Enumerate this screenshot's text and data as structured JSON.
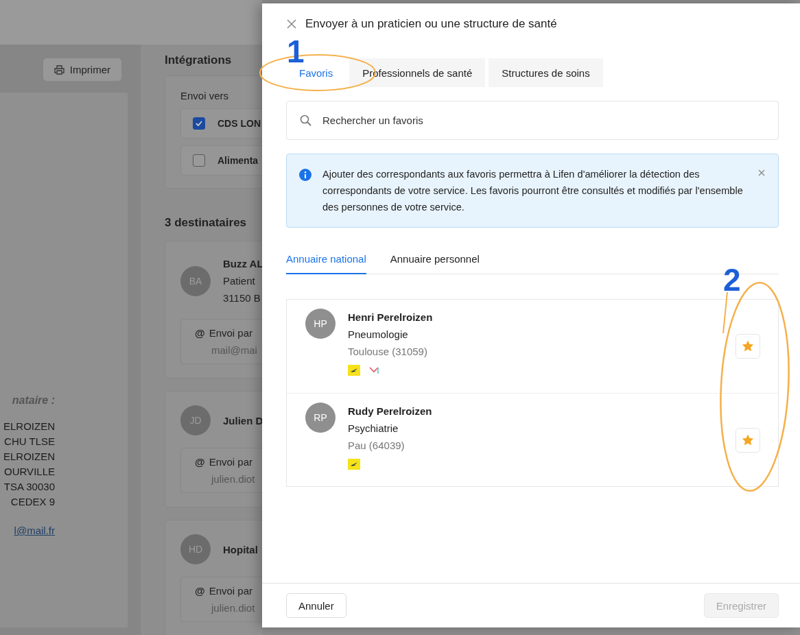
{
  "background": {
    "print_button": "Imprimer",
    "letter": {
      "heading": "nataire :",
      "lines": [
        "ELROIZEN",
        "CHU TLSE",
        "ELROIZEN",
        "OURVILLE",
        "TSA 30030",
        "CEDEX 9"
      ],
      "link": "l@mail.fr"
    },
    "integrations": {
      "title": "Intégrations",
      "subtitle": "Envoi vers",
      "options": [
        {
          "label": "CDS LON",
          "checked": true
        },
        {
          "label": "Alimenta",
          "checked": false
        }
      ]
    },
    "recipients": {
      "title": "3 destinataires",
      "items": [
        {
          "initials": "BA",
          "name": "Buzz AL",
          "lines": [
            "Patient",
            "31150 B"
          ],
          "channel": {
            "icon": "@",
            "label": "Envoi par",
            "address": "mail@mai"
          }
        },
        {
          "initials": "JD",
          "name": "Julien D",
          "channel": {
            "icon": "@",
            "label": "Envoi par",
            "address": "julien.diot"
          }
        },
        {
          "initials": "HD",
          "name": "Hopital",
          "channel": {
            "icon": "@",
            "label": "Envoi par",
            "address": "julien.diot"
          }
        }
      ]
    }
  },
  "drawer": {
    "title": "Envoyer à un praticien ou une structure de santé",
    "tabs": [
      {
        "label": "Favoris",
        "selected": true
      },
      {
        "label": "Professionnels de santé",
        "selected": false
      },
      {
        "label": "Structures de soins",
        "selected": false
      }
    ],
    "search": {
      "placeholder": "Rechercher un favoris"
    },
    "notice": "Ajouter des correspondants aux favoris permettra à Lifen d'améliorer la détection des correspondants de votre service. Les favoris pourront être consultés et modifiés par l'ensemble des personnes de votre service.",
    "directory_tabs": [
      {
        "label": "Annuaire national",
        "selected": true
      },
      {
        "label": "Annuaire personnel",
        "selected": false
      }
    ],
    "contacts": [
      {
        "initials": "HP",
        "name": "Henri Perelroizen",
        "specialty": "Pneumologie",
        "location": "Toulouse (31059)",
        "channels": [
          {
            "kind": "postal"
          },
          {
            "kind": "messaging"
          }
        ],
        "favorite": true
      },
      {
        "initials": "RP",
        "name": "Rudy Perelroizen",
        "specialty": "Psychiatrie",
        "location": "Pau (64039)",
        "channels": [
          {
            "kind": "postal"
          }
        ],
        "favorite": true
      }
    ],
    "buttons": {
      "cancel": {
        "label": "Annuler"
      },
      "save": {
        "label": "Enregistrer",
        "disabled": true
      }
    }
  },
  "annotations": [
    {
      "label": "1"
    },
    {
      "label": "2"
    }
  ]
}
